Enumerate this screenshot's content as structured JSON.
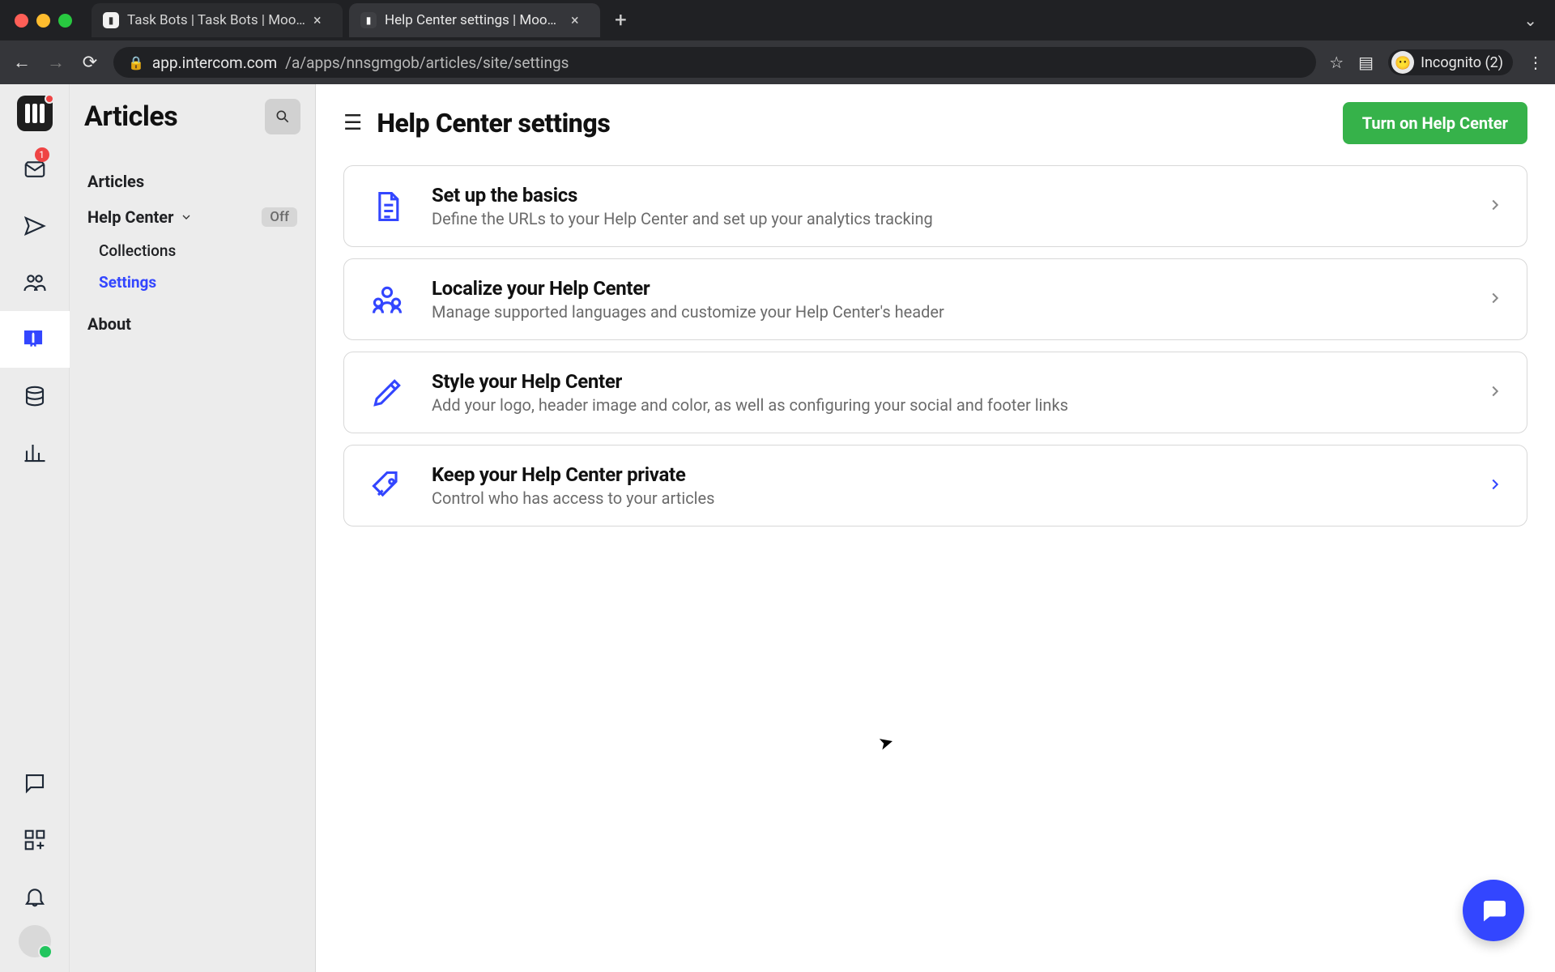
{
  "browser": {
    "tabs": [
      {
        "title": "Task Bots | Task Bots | Moodjo",
        "active": false
      },
      {
        "title": "Help Center settings | Moodjo",
        "active": true
      }
    ],
    "url_host": "app.intercom.com",
    "url_path": "/a/apps/nnsgmgob/articles/site/settings",
    "incognito_label": "Incognito (2)"
  },
  "rail": {
    "inbox_badge": "1"
  },
  "sidebar": {
    "title": "Articles",
    "articles": "Articles",
    "help_center": "Help Center",
    "help_center_status": "Off",
    "collections": "Collections",
    "settings": "Settings",
    "about": "About"
  },
  "main": {
    "title": "Help Center settings",
    "cta": "Turn on Help Center"
  },
  "cards": [
    {
      "title": "Set up the basics",
      "desc": "Define the URLs to your Help Center and set up your analytics tracking"
    },
    {
      "title": "Localize your Help Center",
      "desc": "Manage supported languages and customize your Help Center's header"
    },
    {
      "title": "Style your Help Center",
      "desc": "Add your logo, header image and color, as well as configuring your social and footer links"
    },
    {
      "title": "Keep your Help Center private",
      "desc": "Control who has access to your articles"
    }
  ]
}
